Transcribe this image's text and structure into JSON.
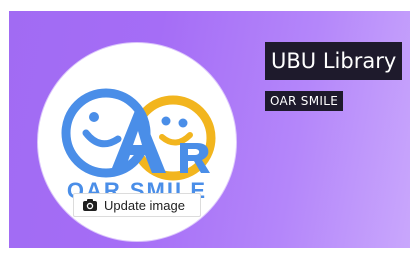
{
  "profile": {
    "name": "UBU Library",
    "handle": "OAR SMILE",
    "update_image_label": "Update image",
    "update_image_icon": "camera-icon"
  },
  "logo": {
    "text": "OAR SMILE"
  },
  "colors": {
    "banner_start": "#a16bf3",
    "banner_end": "#c9a7fc",
    "chip_bg": "#1e1a2c",
    "logo_blue": "#4a8ee8",
    "logo_gold": "#f2b51e"
  }
}
